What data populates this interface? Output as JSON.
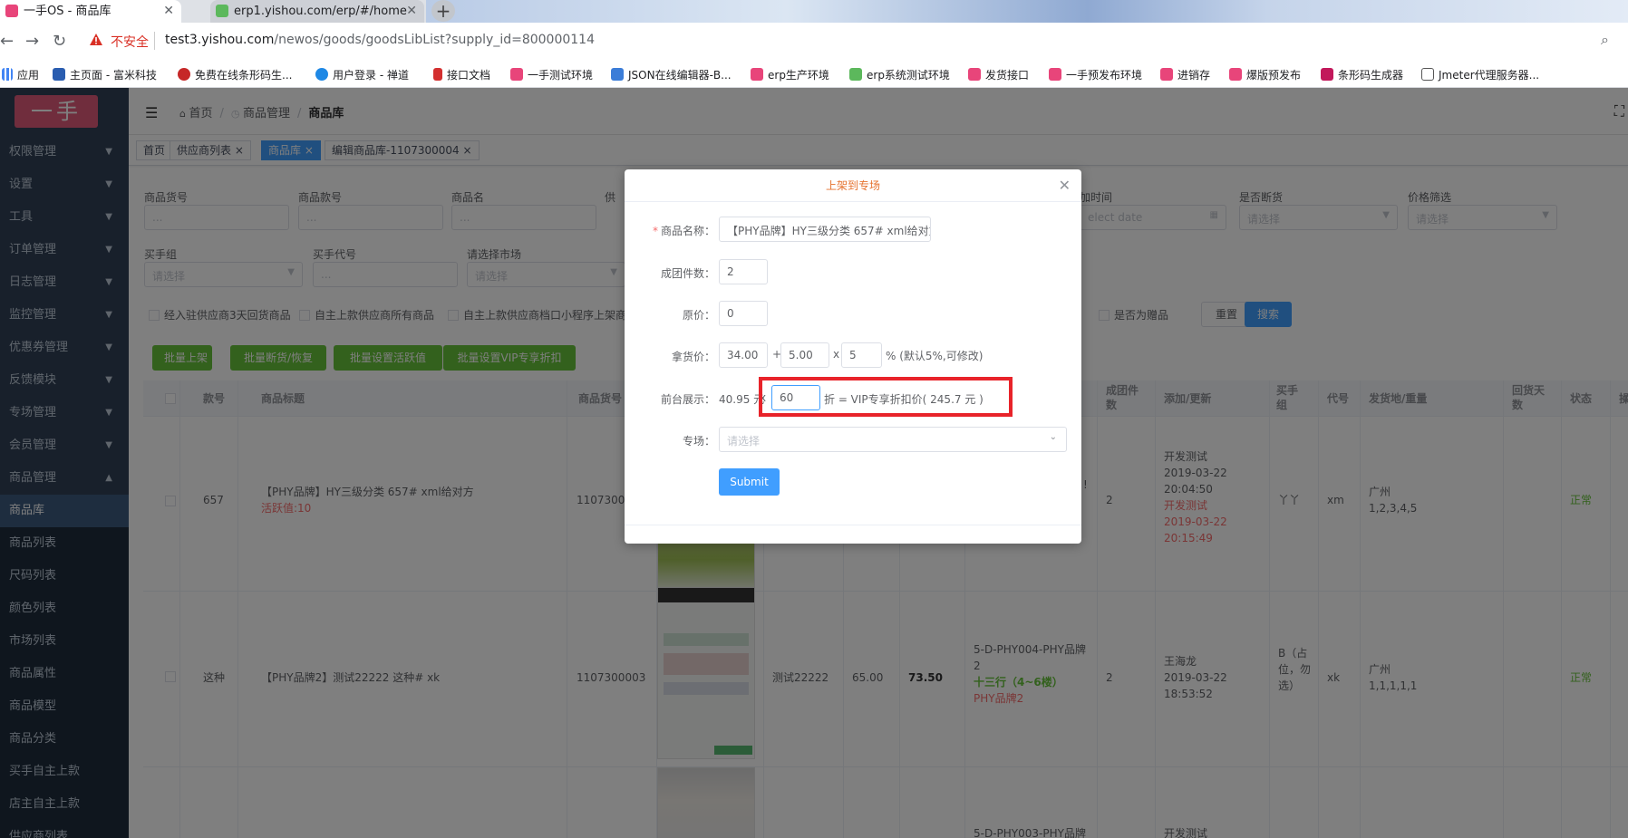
{
  "browser": {
    "tabs": [
      {
        "title": "一手OS - 商品库"
      },
      {
        "title": "erp1.yishou.com/erp/#/home"
      }
    ],
    "new_tab": "+",
    "not_secure": "不安全",
    "url_host": "test3.yishou.com",
    "url_path": "/newos/goods/goodsLibList?supply_id=800000114",
    "bookmarks": [
      "应用",
      "主页面 - 富米科技",
      "免费在线条形码生...",
      "用户登录 - 禅道",
      "接口文档",
      "一手测试环境",
      "JSON在线编辑器-B...",
      "erp生产环境",
      "erp系统测试环境",
      "发货接口",
      "一手预发布环境",
      "进销存",
      "爆版预发布",
      "条形码生成器",
      "Jmeter代理服务器..."
    ]
  },
  "sidebar": {
    "logo": "一手",
    "items": [
      "权限管理",
      "设置",
      "工具",
      "订单管理",
      "日志管理",
      "监控管理",
      "优惠券管理",
      "反馈模块",
      "专场管理",
      "会员管理",
      "商品管理"
    ],
    "sub_items": [
      "商品库",
      "商品列表",
      "尺码列表",
      "颜色列表",
      "市场列表",
      "商品属性",
      "商品模型",
      "商品分类",
      "买手自主上款",
      "店主自主上款",
      "供应商列表"
    ]
  },
  "breadcrumb": {
    "home": "首页",
    "parent": "商品管理",
    "current": "商品库"
  },
  "tags": [
    "首页",
    "供应商列表",
    "商品库",
    "编辑商品库-1107300004"
  ],
  "filters": {
    "labels": [
      "商品货号",
      "商品款号",
      "商品名",
      "供",
      "加时间",
      "是否断货",
      "价格筛选",
      "买手组",
      "买手代号",
      "请选择市场"
    ],
    "placeholders": {
      "select": "请选择",
      "date": "elect date"
    },
    "checkboxes": [
      "经入驻供应商3天回货商品",
      "自主上款供应商所有商品",
      "自主上款供应商档口小程序上架商",
      "是否为赠品"
    ],
    "reset": "重置",
    "search": "搜索"
  },
  "actions": [
    "批量上架",
    "批量断货/恢复",
    "批量设置活跃值",
    "批量设置VIP专享折扣"
  ],
  "table": {
    "headers": [
      "款号",
      "商品标题",
      "商品货号",
      "成团件数",
      "添加/更新",
      "买手组",
      "代号",
      "发货地/重量",
      "回货天数",
      "状态",
      "操"
    ],
    "rows": [
      {
        "style": "657",
        "title": "【PHY品牌】HY三级分类 657# xml给对方",
        "active": "活跃值:10",
        "sku": "11073000",
        "group_qty": "2",
        "updated_by": "开发测试",
        "updated_time": "2019-03-22 20:04:50",
        "created_by": "开发测试",
        "created_time": "2019-03-22 20:15:49",
        "buyer_group": "丫丫",
        "code": "xm",
        "ship_from": "广州",
        "weight": "1,2,3,4,5",
        "status": "正常",
        "market": "!"
      },
      {
        "style": "这种",
        "title": "【PHY品牌2】测试22222 这种# xk",
        "sku": "1107300003",
        "name": "测试22222",
        "price": "65.00",
        "sale": "73.50",
        "location1": "5-D-PHY004-PHY品牌2",
        "location2": "十三行（4~6楼）",
        "location3": "PHY品牌2",
        "group_qty": "2",
        "updated_by": "王海龙",
        "updated_time": "2019-03-22 18:53:52",
        "buyer_group": "B（占位，勿选）",
        "code": "xk",
        "ship_from": "广州",
        "weight": "1,1,1,1,1",
        "status": "正常"
      },
      {
        "location1": "5-D-PHY003-PHY品牌",
        "updated_by": "开发测试"
      }
    ]
  },
  "dialog": {
    "title": "上架到专场",
    "labels": {
      "name": "商品名称：",
      "group_qty": "成团件数：",
      "orig_price": "原价：",
      "supply_price": "拿货价：",
      "display": "前台展示：",
      "topic": "专场："
    },
    "name_value": "【PHY品牌】HY三级分类 657# xml给对方",
    "group_qty": "2",
    "orig_price": "0",
    "price_a": "34.00",
    "price_b": "5.00",
    "price_c": "5",
    "plus": "+",
    "times": "x",
    "price_note": "% (默认5%,可修改)",
    "display_price": "40.95 元",
    "display_times": "x",
    "discount": "60",
    "vip_text": "折 = VIP专享折扣价( 245.7 元 )",
    "topic_placeholder": "请选择",
    "submit": "Submit",
    "required_mark": "*"
  },
  "colors": {
    "sidebar": "#304156",
    "primary": "#409eff",
    "success": "#67c23a",
    "danger": "#f56c6c",
    "highlight": "#e8232a"
  }
}
